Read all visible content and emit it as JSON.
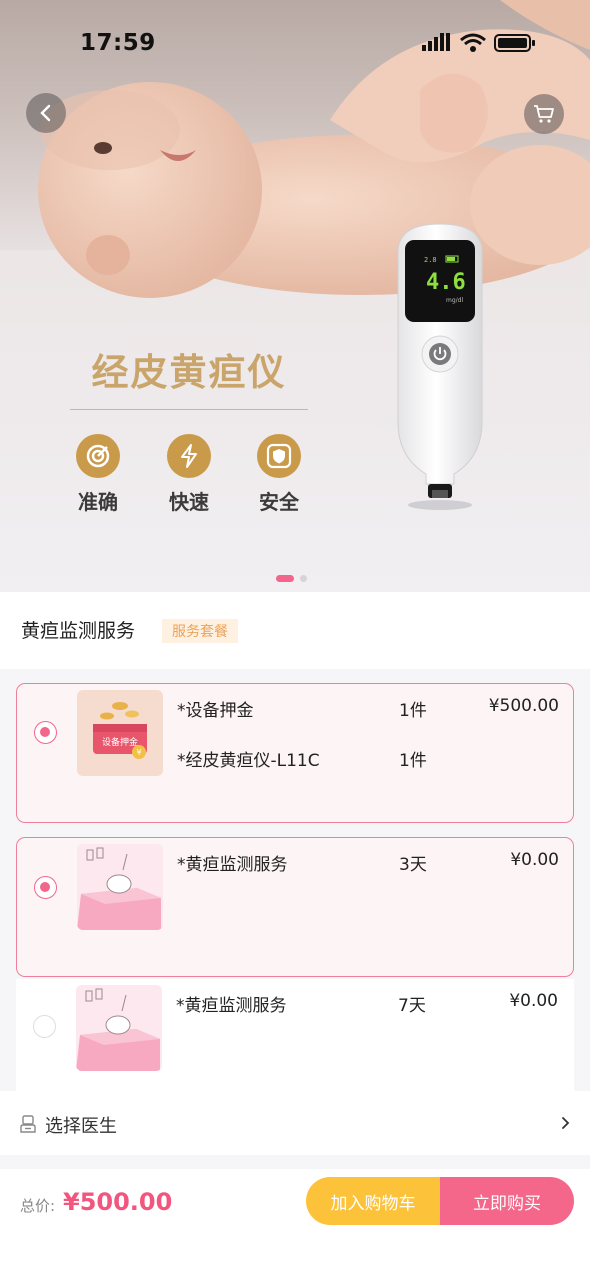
{
  "status_bar": {
    "time": "17:59"
  },
  "hero": {
    "product_title": "经皮黄疸仪",
    "features": [
      {
        "label": "准确",
        "icon": "target-icon"
      },
      {
        "label": "快速",
        "icon": "lightning-icon"
      },
      {
        "label": "安全",
        "icon": "shield-icon"
      }
    ],
    "device_screen": {
      "reading": "4.6",
      "small_value": "2.8",
      "unit": "mg/dl"
    },
    "carousel": {
      "active_index": 0,
      "count": 2
    }
  },
  "service": {
    "title": "黄疸监测服务",
    "tag": "服务套餐"
  },
  "packages": [
    {
      "selected": true,
      "thumb_label": "设备押金",
      "items": [
        {
          "name": "*设备押金",
          "qty": "1件",
          "price": "¥500.00"
        },
        {
          "name": "*经皮黄疸仪-L11C",
          "qty": "1件",
          "price": ""
        }
      ]
    },
    {
      "selected": true,
      "items": [
        {
          "name": "*黄疸监测服务",
          "qty": "3天",
          "price": "¥0.00"
        }
      ]
    },
    {
      "selected": false,
      "items": [
        {
          "name": "*黄疸监测服务",
          "qty": "7天",
          "price": "¥0.00"
        }
      ]
    }
  ],
  "doctor": {
    "label": "选择医生"
  },
  "footer": {
    "total_label": "总价:",
    "total_value": "¥500.00",
    "add_cart": "加入购物车",
    "buy_now": "立即购买"
  },
  "colors": {
    "accent": "#f2668b",
    "gold": "#c99a4a",
    "cart_btn": "#fcc33a",
    "buy_btn": "#f4668a"
  }
}
